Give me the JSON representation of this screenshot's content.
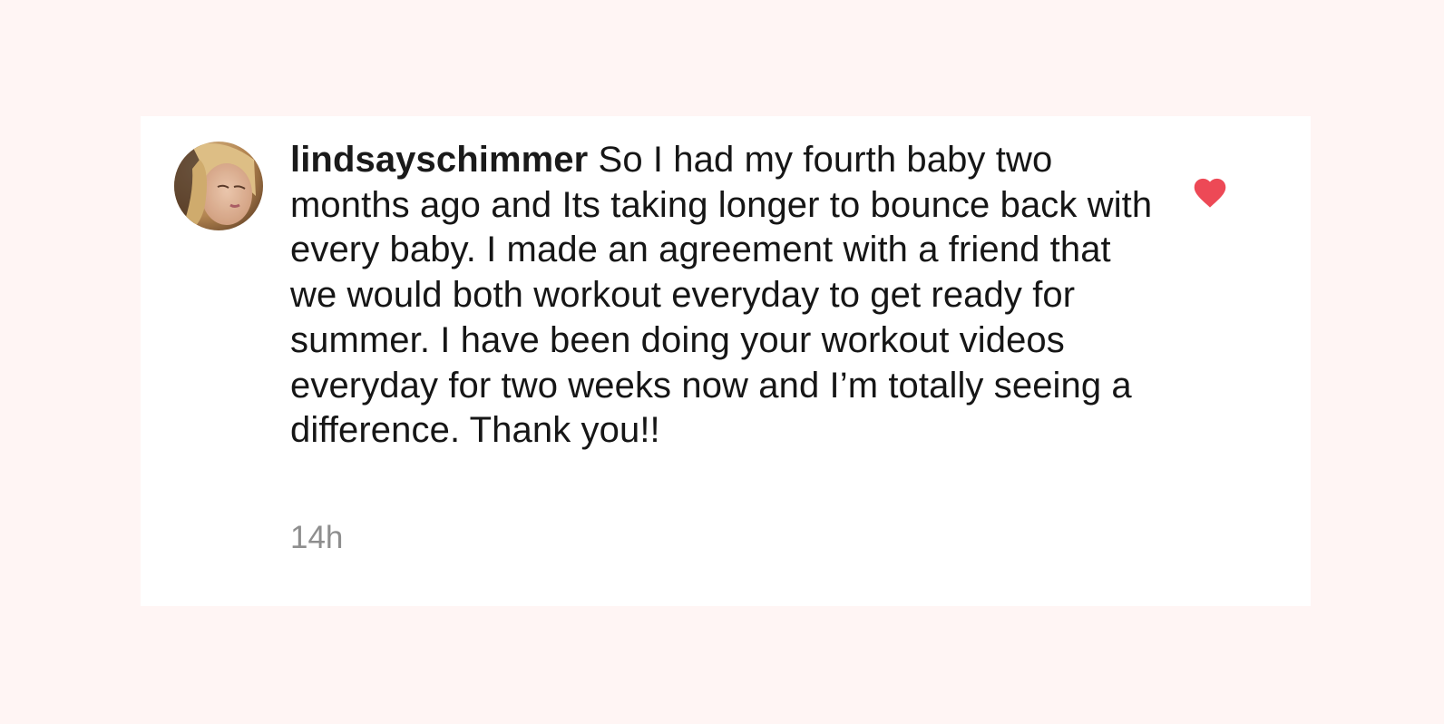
{
  "comment": {
    "username": "lindsayschimmer",
    "text": "So I had my fourth baby two months ago and Its taking longer to bounce back with every baby. I made an agreement with a friend that we would both workout everyday to get ready for summer. I have been doing your workout videos everyday for two weeks now and I’m totally seeing a difference. Thank you!!",
    "timestamp": "14h",
    "liked": true
  },
  "icons": {
    "like": "heart-icon",
    "avatar": "avatar"
  },
  "colors": {
    "background": "#fff5f4",
    "card": "#ffffff",
    "heart": "#ed4956",
    "timestamp": "#8e8e8e"
  }
}
